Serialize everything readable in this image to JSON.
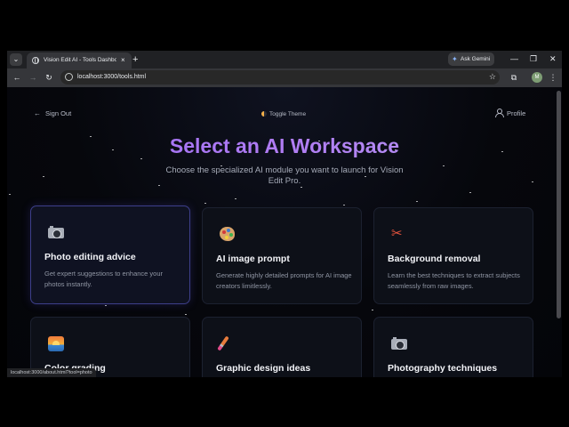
{
  "browser": {
    "tab_title": "Vision Edit AI - Tools Dashboard",
    "tab_close": "×",
    "new_tab": "+",
    "tab_list": "⌄",
    "gemini_label": "Ask Gemini",
    "window_minimize": "—",
    "window_restore": "❐",
    "window_close": "✕",
    "url": "localhost:3000/tools.html",
    "profile_initial": "M",
    "menu": "⋮",
    "status_url": "localhost:3000/about.html?tool=photo"
  },
  "header": {
    "sign_out": "Sign Out",
    "toggle_theme": "Toggle Theme",
    "profile": "Profile"
  },
  "hero": {
    "title": "Select an AI Workspace",
    "subtitle": "Choose the specialized AI module you want to launch for Vision Edit Pro."
  },
  "cards": [
    {
      "icon": "camera-icon",
      "title": "Photo editing advice",
      "description": "Get expert suggestions to enhance your photos instantly."
    },
    {
      "icon": "palette-icon",
      "title": "AI image prompt",
      "description": "Generate highly detailed prompts for AI image creators limitlessly."
    },
    {
      "icon": "scissors-icon",
      "title": "Background removal",
      "description": "Learn the best techniques to extract subjects seamlessly from raw images."
    },
    {
      "icon": "sunset-icon",
      "title": "Color grading",
      "description": ""
    },
    {
      "icon": "paintbrush-icon",
      "title": "Graphic design ideas",
      "description": ""
    },
    {
      "icon": "camera-icon",
      "title": "Photography techniques",
      "description": ""
    }
  ],
  "colors": {
    "accent_purple": "#9b6cf5",
    "page_background": "#06070c",
    "card_background": "#0d1018",
    "active_card_border": "#3d3f8a"
  }
}
